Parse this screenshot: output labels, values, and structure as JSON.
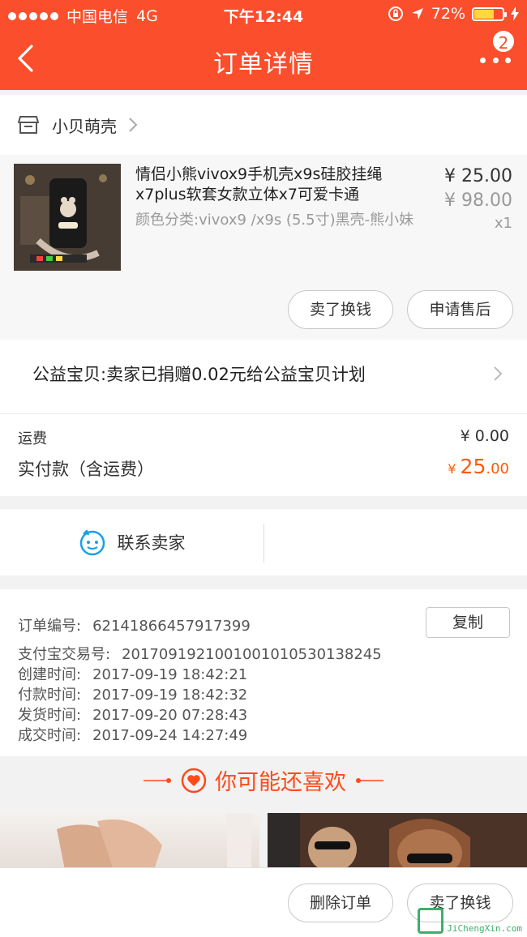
{
  "status_bar": {
    "carrier": "中国电信",
    "network": "4G",
    "time": "下午12:44",
    "battery_percent": "72%",
    "battery_level": 0.72,
    "battery_color": "#ffd93b"
  },
  "nav": {
    "title": "订单详情",
    "badge": "2",
    "bg_color": "#fb4e2c"
  },
  "shop": {
    "name": "小贝萌壳"
  },
  "item": {
    "title": "情侣小熊vivox9手机壳x9s硅胶挂绳x7plus软套女款立体x7可爱卡通",
    "spec": "颜色分类:vivox9 /x9s (5.5寸)黑壳-熊小妹",
    "price_now": "¥ 25.00",
    "price_old": "¥ 98.00",
    "qty": "x1",
    "btn_sell": "卖了换钱",
    "btn_aftersale": "申请售后"
  },
  "charity": {
    "text": "公益宝贝:卖家已捐赠0.02元给公益宝贝计划"
  },
  "fees": {
    "shipping_label": "运费",
    "shipping_value": "¥ 0.00",
    "paid_label": "实付款（含运费）",
    "paid_currency": "¥ ",
    "paid_int": "25",
    "paid_dec": ".00",
    "accent_color": "#ff5a00"
  },
  "contact": {
    "label": "联系卖家"
  },
  "order_info": {
    "copy_label": "复制",
    "rows": [
      {
        "label": "订单编号:",
        "value": "62141866457917399"
      },
      {
        "label": "支付宝交易号:",
        "value": "2017091921001001010530138245"
      },
      {
        "label": "创建时间:",
        "value": "2017-09-19 18:42:21"
      },
      {
        "label": "付款时间:",
        "value": "2017-09-19 18:42:32"
      },
      {
        "label": "发货时间:",
        "value": "2017-09-20 07:28:43"
      },
      {
        "label": "成交时间:",
        "value": "2017-09-24 14:27:49"
      }
    ]
  },
  "recommend": {
    "title": "你可能还喜欢"
  },
  "bottom": {
    "btn_delete": "删除订单",
    "btn_sell": "卖了换钱"
  },
  "watermark": {
    "text": "JiChengXin.com"
  }
}
